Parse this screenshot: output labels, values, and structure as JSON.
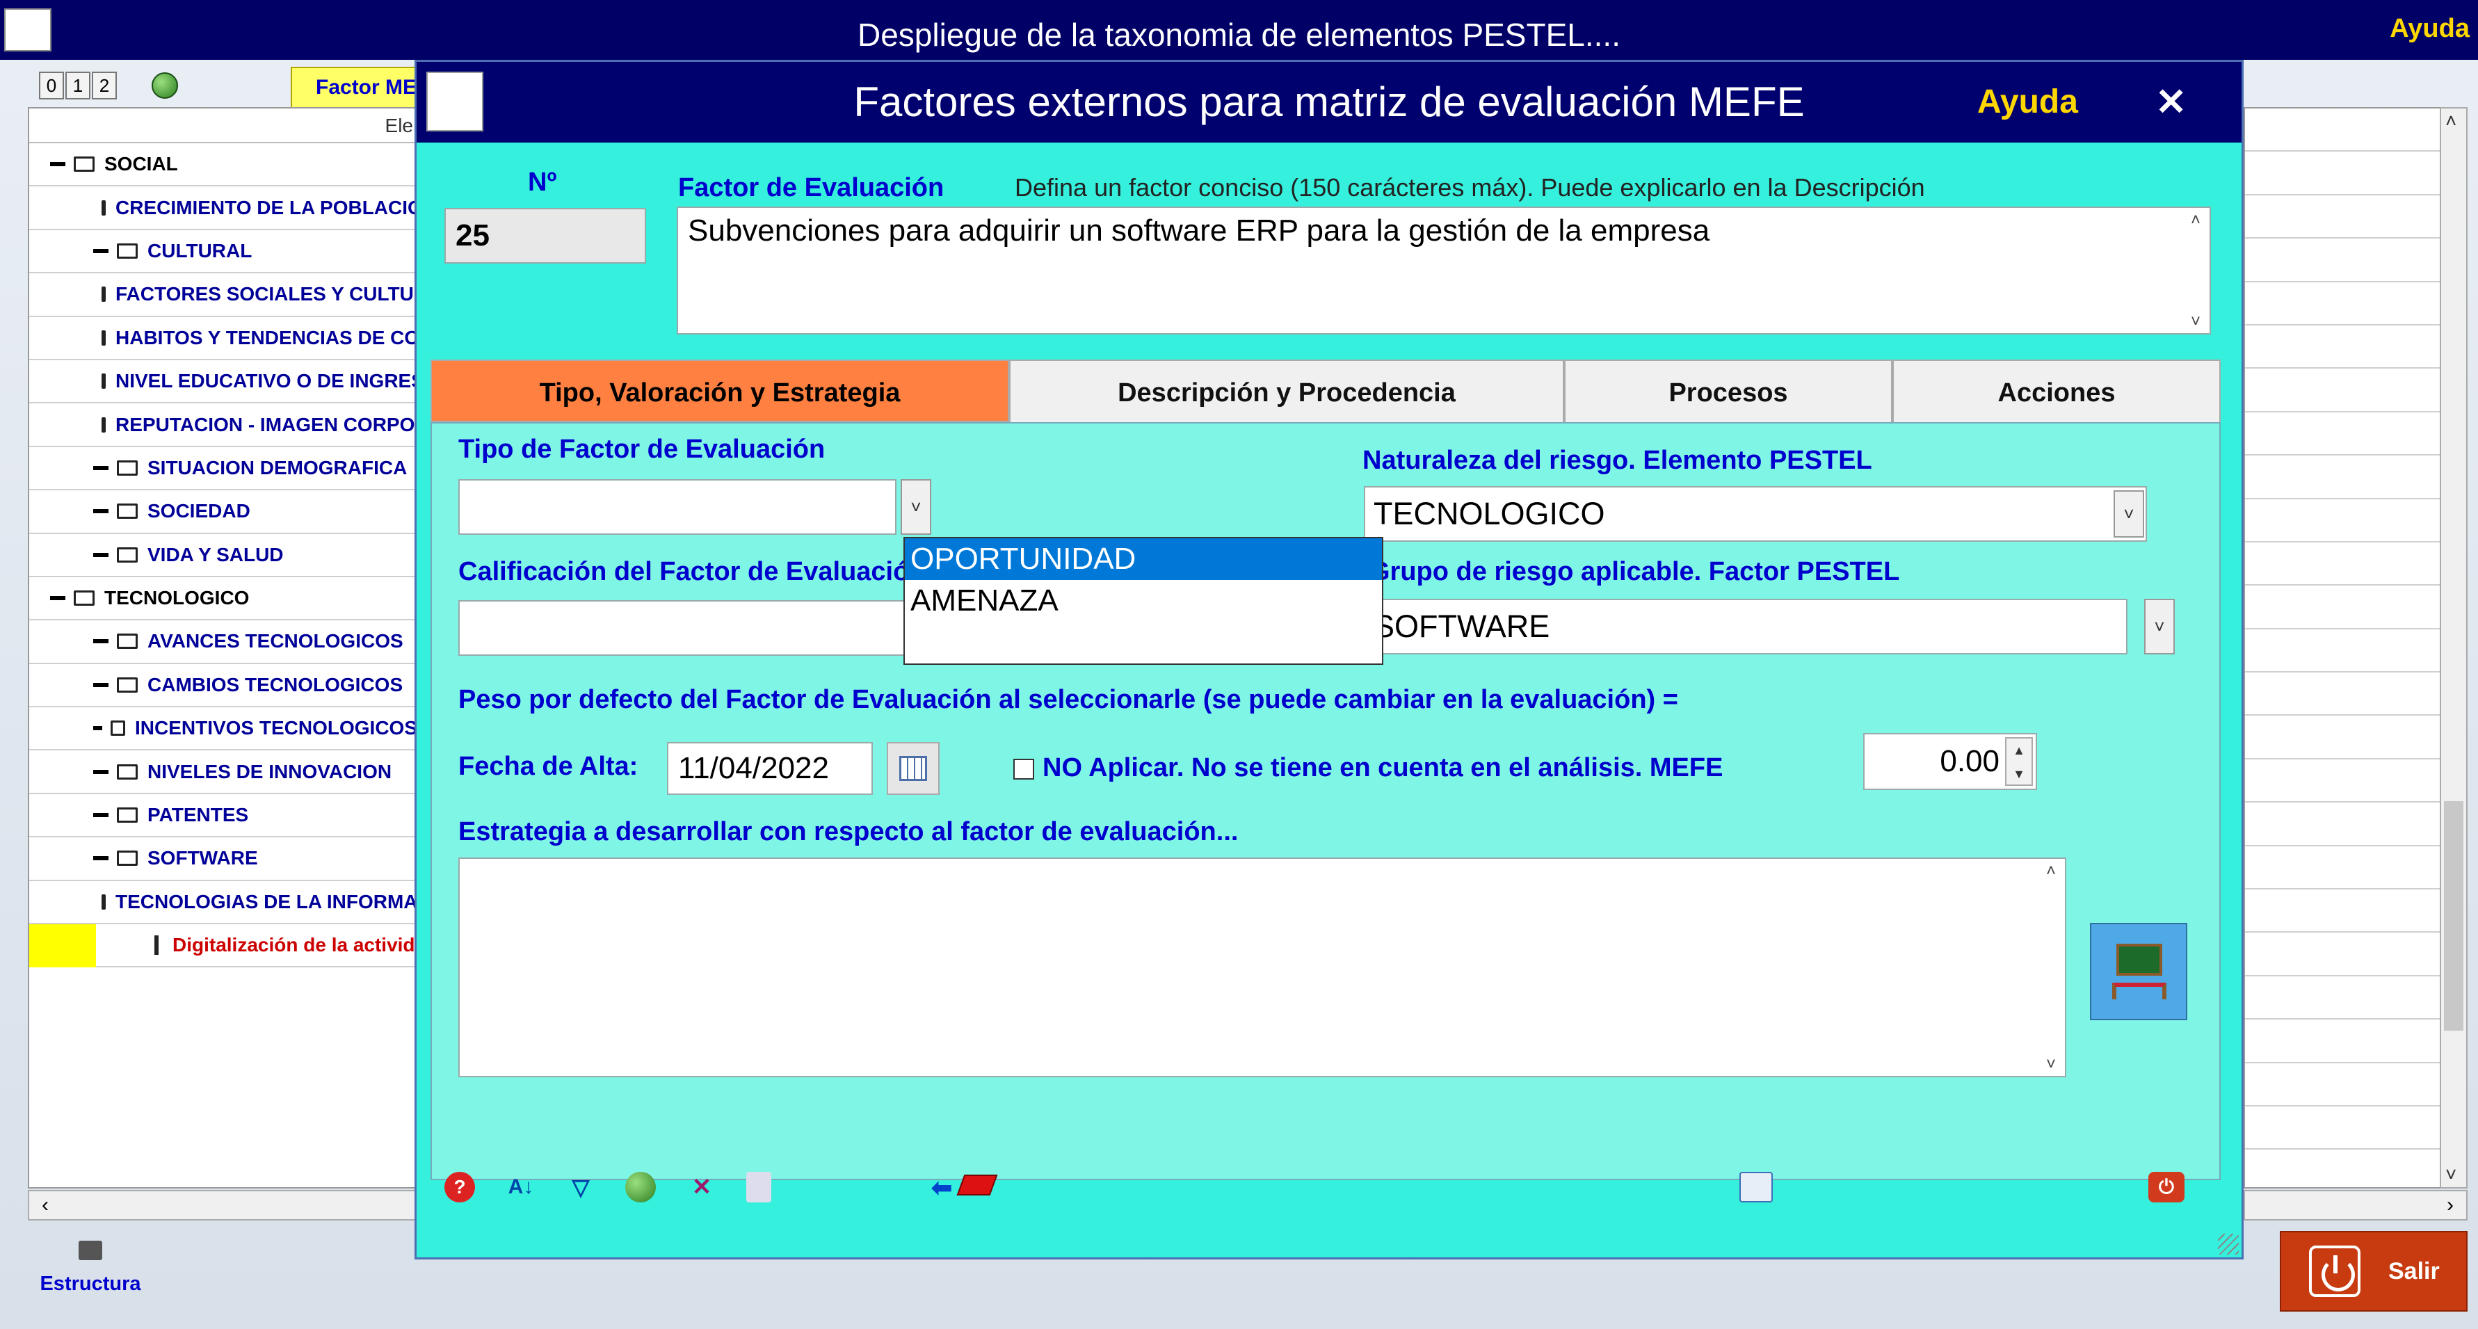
{
  "outer_window": {
    "title": "Despliegue de la taxonomia de elementos PESTEL....",
    "help": "Ayuda",
    "level_buttons": [
      "0",
      "1",
      "2"
    ],
    "factor_tab": "Factor MEFE",
    "tree_header": "Ele",
    "tree": [
      {
        "label": "SOCIAL",
        "level": 0
      },
      {
        "label": "CRECIMIENTO DE LA POBLACION",
        "level": 1
      },
      {
        "label": "CULTURAL",
        "level": 1
      },
      {
        "label": "FACTORES SOCIALES Y CULTURALES",
        "level": 1
      },
      {
        "label": "HABITOS Y TENDENCIAS DE CONSUMO",
        "level": 1
      },
      {
        "label": "NIVEL EDUCATIVO O DE INGRESOS",
        "level": 1
      },
      {
        "label": "REPUTACION - IMAGEN CORPORATIVA",
        "level": 1
      },
      {
        "label": "SITUACION DEMOGRAFICA",
        "level": 1
      },
      {
        "label": "SOCIEDAD",
        "level": 1
      },
      {
        "label": "VIDA Y SALUD",
        "level": 1
      },
      {
        "label": "TECNOLOGICO",
        "level": 0
      },
      {
        "label": "AVANCES TECNOLOGICOS",
        "level": 1
      },
      {
        "label": "CAMBIOS TECNOLOGICOS",
        "level": 1
      },
      {
        "label": "INCENTIVOS TECNOLOGICOS",
        "level": 1
      },
      {
        "label": "NIVELES DE INNOVACION",
        "level": 1
      },
      {
        "label": "PATENTES",
        "level": 1
      },
      {
        "label": "SOFTWARE",
        "level": 1
      },
      {
        "label": "TECNOLOGIAS DE LA INFORMACION",
        "level": 1
      },
      {
        "label": "Digitalización de la actividad",
        "level": 2
      }
    ],
    "structure_label": "Estructura",
    "exit_label": "Salir"
  },
  "dialog": {
    "title": "Factores externos para matriz de evaluación MEFE",
    "help": "Ayuda",
    "close": "✕",
    "number_label": "Nº",
    "number_value": "25",
    "factor_label": "Factor de Evaluación",
    "factor_hint": "Defina un factor conciso (150 carácteres máx). Puede explicarlo en la Descripción",
    "factor_value": "Subvenciones para adquirir un software ERP para la gestión de la empresa",
    "tabs": [
      "Tipo, Valoración y Estrategia",
      "Descripción y Procedencia",
      "Procesos",
      "Acciones"
    ],
    "tipo_label": "Tipo de Factor de Evaluación",
    "tipo_value": "",
    "tipo_options": [
      "OPORTUNIDAD",
      "AMENAZA"
    ],
    "naturaleza_label": "Naturaleza del riesgo. Elemento PESTEL",
    "naturaleza_value": "TECNOLOGICO",
    "calificacion_label": "Calificación del Factor de Evaluación",
    "grupo_label": "Grupo de riesgo aplicable. Factor PESTEL",
    "grupo_value": "SOFTWARE",
    "peso_label": "Peso por defecto del Factor de Evaluación al seleccionarle (se puede cambiar en la evaluación) =",
    "peso_value": "0.00",
    "fecha_label": "Fecha de Alta:",
    "fecha_value": "11/04/2022",
    "no_aplicar_label": "NO Aplicar. No se tiene en cuenta en el análisis. MEFE",
    "estrategia_label": "Estrategia a desarrollar con respecto al factor de evaluación...",
    "estrategia_value": ""
  }
}
